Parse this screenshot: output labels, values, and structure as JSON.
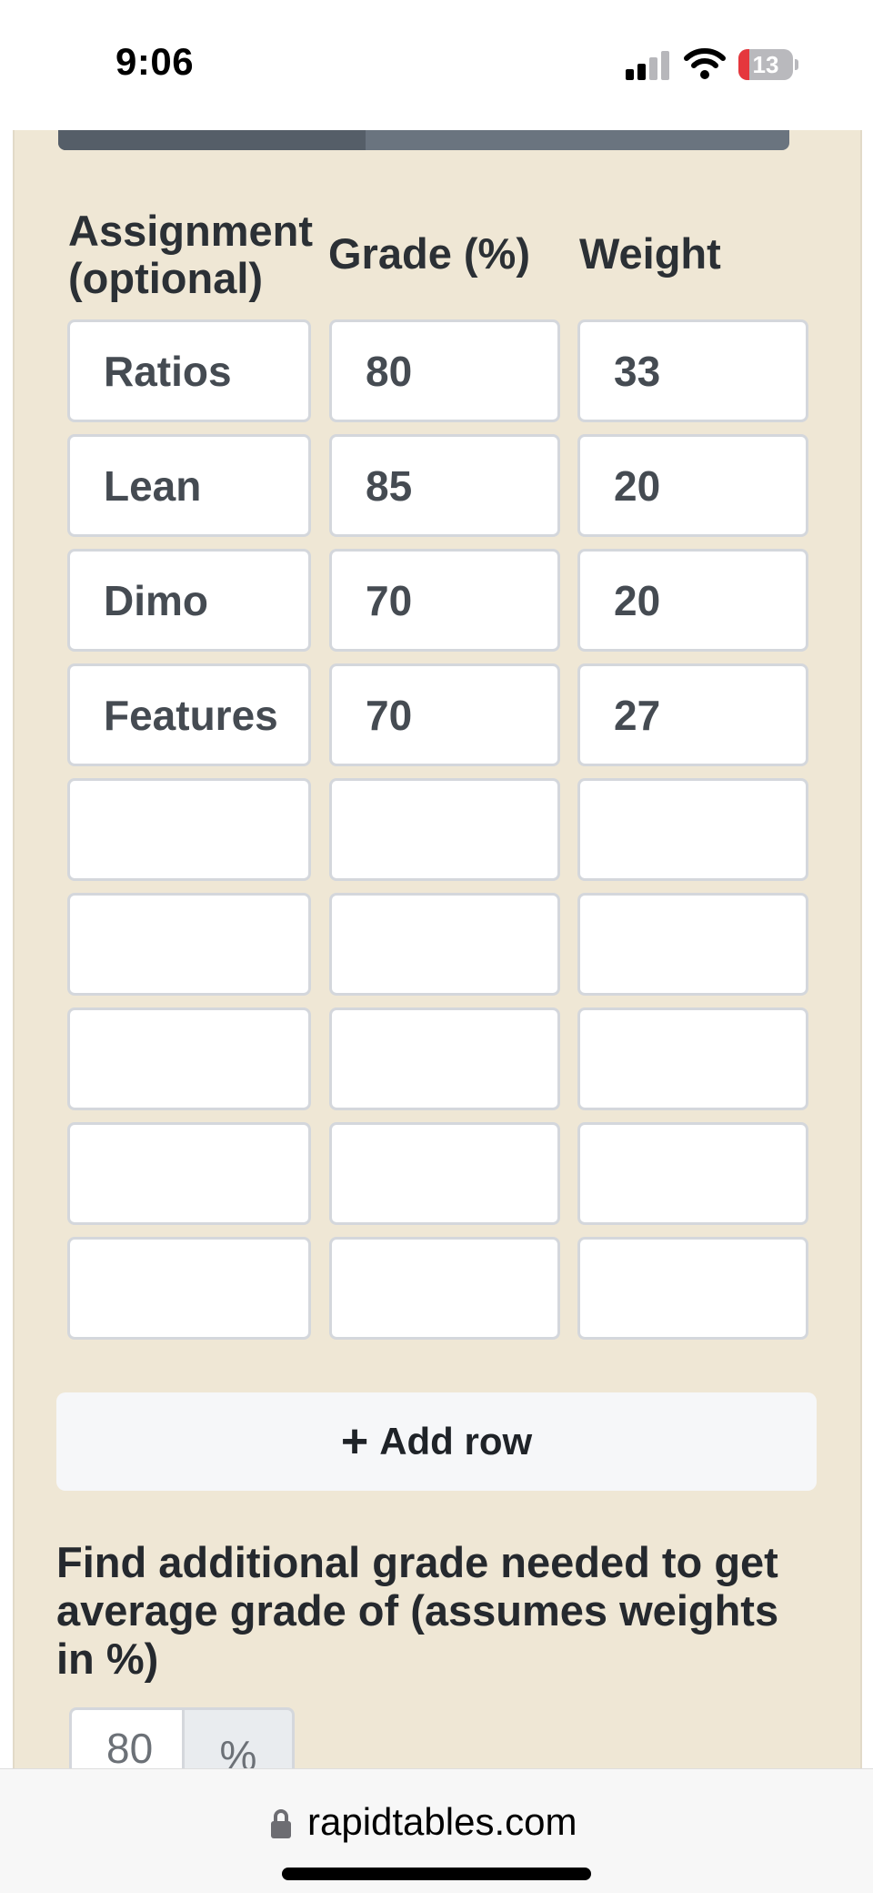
{
  "status_bar": {
    "time": "9:06",
    "battery_level": "13",
    "signal_bars_active": 2,
    "signal_bars_total": 4
  },
  "progress": {
    "fill_fraction": 0.42
  },
  "table": {
    "headers": {
      "assignment": "Assignment (optional)",
      "grade": "Grade (%)",
      "weight": "Weight"
    },
    "rows": [
      {
        "assignment": "Ratios",
        "grade": "80",
        "weight": "33"
      },
      {
        "assignment": "Lean",
        "grade": "85",
        "weight": "20"
      },
      {
        "assignment": "Dimo",
        "grade": "70",
        "weight": "20"
      },
      {
        "assignment": "Features",
        "grade": "70",
        "weight": "27"
      },
      {
        "assignment": "",
        "grade": "",
        "weight": ""
      },
      {
        "assignment": "",
        "grade": "",
        "weight": ""
      },
      {
        "assignment": "",
        "grade": "",
        "weight": ""
      },
      {
        "assignment": "",
        "grade": "",
        "weight": ""
      },
      {
        "assignment": "",
        "grade": "",
        "weight": ""
      }
    ]
  },
  "add_row": {
    "icon": "plus-icon",
    "label": "Add row"
  },
  "find_grade": {
    "text": "Find additional grade needed to get average grade of (assumes weights in %)",
    "target_value": "80",
    "unit": "%"
  },
  "browser": {
    "url": "rapidtables.com",
    "icon": "lock-icon"
  },
  "colors": {
    "panel_background": "#efe7d5",
    "progress_track": "#6a747f",
    "progress_fill": "#555e68",
    "input_border": "#d4d7dc",
    "battery_low": "#e5373d"
  }
}
